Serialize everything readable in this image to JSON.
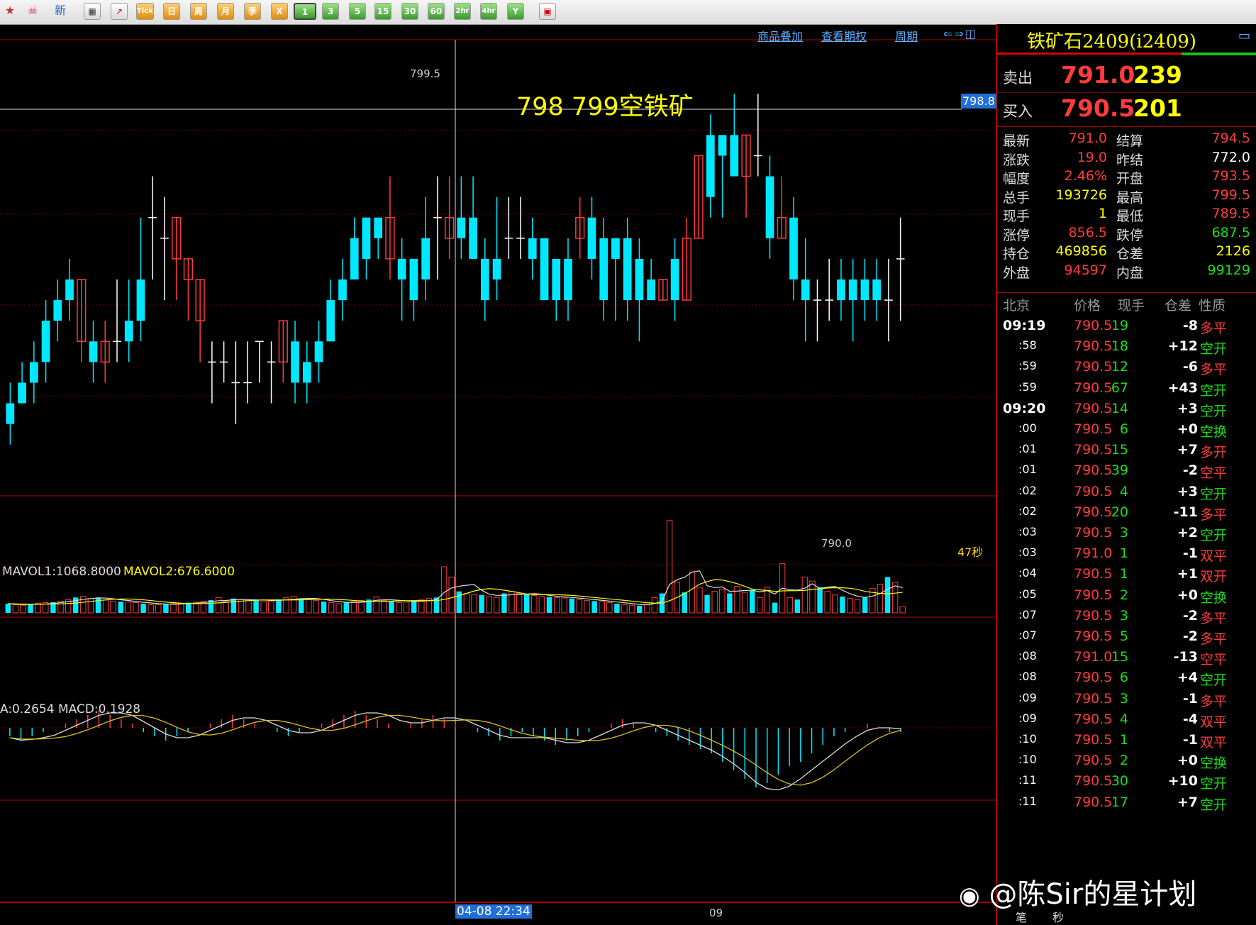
{
  "toolbar": {
    "buttons": [
      "新",
      "Tick",
      "日",
      "周",
      "月",
      "季",
      "X",
      "1",
      "3",
      "5",
      "15",
      "30",
      "60",
      "2hr",
      "4hr",
      "Y"
    ]
  },
  "chart_header": {
    "links": [
      "商品叠加",
      "查看期权",
      "周期"
    ]
  },
  "price_chart": {
    "high_label": "799.5",
    "low_label": "790.0",
    "cursor_price": "798.8",
    "annotation": "798 799空铁矿",
    "countdown": "47秒"
  },
  "volume_panel": {
    "legend1": "MAVOL1:1068.8000",
    "legend2": "MAVOL2:676.6000"
  },
  "macd_panel": {
    "legend": "A:0.2654 MACD:0.1928"
  },
  "time_axis": {
    "cursor_time": "04-08 22:34",
    "tick": "09"
  },
  "quote": {
    "title": "铁矿石2409(i2409)",
    "sell_label": "卖出",
    "sell_price": "791.0",
    "sell_qty": "239",
    "buy_label": "买入",
    "buy_price": "790.5",
    "buy_qty": "201",
    "stats": [
      {
        "l1": "最新",
        "v1": "791.0",
        "l2": "结算",
        "v2": "794.5"
      },
      {
        "l1": "涨跌",
        "v1": "19.0",
        "l2": "昨结",
        "v2": "772.0"
      },
      {
        "l1": "幅度",
        "v1": "2.46%",
        "l2": "开盘",
        "v2": "793.5"
      },
      {
        "l1": "总手",
        "v1": "193726",
        "l2": "最高",
        "v2": "799.5"
      },
      {
        "l1": "现手",
        "v1": "1",
        "l2": "最低",
        "v2": "789.5"
      },
      {
        "l1": "涨停",
        "v1": "856.5",
        "l2": "跌停",
        "v2": "687.5"
      },
      {
        "l1": "持仓",
        "v1": "469856",
        "l2": "仓差",
        "v2": "2126"
      },
      {
        "l1": "外盘",
        "v1": "94597",
        "l2": "内盘",
        "v2": "99129"
      }
    ],
    "trades_header": [
      "北京",
      "价格",
      "现手",
      "仓差",
      "性质"
    ],
    "trades": [
      {
        "t": "09:19",
        "p": "790.5",
        "q": "19",
        "d": "-8",
        "n": "多平"
      },
      {
        "t": ":58",
        "p": "790.5",
        "q": "18",
        "d": "+12",
        "n": "空开"
      },
      {
        "t": ":59",
        "p": "790.5",
        "q": "12",
        "d": "-6",
        "n": "多平"
      },
      {
        "t": ":59",
        "p": "790.5",
        "q": "67",
        "d": "+43",
        "n": "空开"
      },
      {
        "t": "09:20",
        "p": "790.5",
        "q": "14",
        "d": "+3",
        "n": "空开"
      },
      {
        "t": ":00",
        "p": "790.5",
        "q": "6",
        "d": "+0",
        "n": "空换"
      },
      {
        "t": ":01",
        "p": "790.5",
        "q": "15",
        "d": "+7",
        "n": "多开"
      },
      {
        "t": ":01",
        "p": "790.5",
        "q": "39",
        "d": "-2",
        "n": "空平"
      },
      {
        "t": ":02",
        "p": "790.5",
        "q": "4",
        "d": "+3",
        "n": "空开"
      },
      {
        "t": ":02",
        "p": "790.5",
        "q": "20",
        "d": "-11",
        "n": "多平"
      },
      {
        "t": ":03",
        "p": "790.5",
        "q": "3",
        "d": "+2",
        "n": "空开"
      },
      {
        "t": ":03",
        "p": "791.0",
        "q": "1",
        "d": "-1",
        "n": "双平"
      },
      {
        "t": ":04",
        "p": "790.5",
        "q": "1",
        "d": "+1",
        "n": "双开"
      },
      {
        "t": ":05",
        "p": "790.5",
        "q": "2",
        "d": "+0",
        "n": "空换"
      },
      {
        "t": ":07",
        "p": "790.5",
        "q": "3",
        "d": "-2",
        "n": "多平"
      },
      {
        "t": ":07",
        "p": "790.5",
        "q": "5",
        "d": "-2",
        "n": "多平"
      },
      {
        "t": ":08",
        "p": "791.0",
        "q": "15",
        "d": "-13",
        "n": "空平"
      },
      {
        "t": ":08",
        "p": "790.5",
        "q": "6",
        "d": "+4",
        "n": "空开"
      },
      {
        "t": ":09",
        "p": "790.5",
        "q": "3",
        "d": "-1",
        "n": "多平"
      },
      {
        "t": ":09",
        "p": "790.5",
        "q": "4",
        "d": "-4",
        "n": "双平"
      },
      {
        "t": ":10",
        "p": "790.5",
        "q": "1",
        "d": "-1",
        "n": "双平"
      },
      {
        "t": ":10",
        "p": "790.5",
        "q": "2",
        "d": "+0",
        "n": "空换"
      },
      {
        "t": ":11",
        "p": "790.5",
        "q": "30",
        "d": "+10",
        "n": "空开"
      },
      {
        "t": ":11",
        "p": "790.5",
        "q": "17",
        "d": "+7",
        "n": "空开"
      }
    ],
    "bottom_tabs": [
      "笔",
      "秒"
    ]
  },
  "watermark": "@陈Sir的星计划",
  "colors": {
    "up": "#ff3b3b",
    "down": "#00e8ff",
    "yellow": "#ffff00",
    "grid": "#7a0000"
  },
  "chart_data": {
    "type": "candlestick",
    "ohlc": [
      [
        792.0,
        791.5,
        792.5,
        791.0
      ],
      [
        792.5,
        792.0,
        793.0,
        792.0
      ],
      [
        793.0,
        792.5,
        793.5,
        792.0
      ],
      [
        794.0,
        793.0,
        794.5,
        792.5
      ],
      [
        794.5,
        794.0,
        795.0,
        793.5
      ],
      [
        795.0,
        794.5,
        795.5,
        794.0
      ],
      [
        793.5,
        795.0,
        795.0,
        793.0
      ],
      [
        793.5,
        793.0,
        794.0,
        792.5
      ],
      [
        793.0,
        793.5,
        794.0,
        792.5
      ],
      [
        793.5,
        793.5,
        795.0,
        793.0
      ],
      [
        794.0,
        793.5,
        795.0,
        793.0
      ],
      [
        795.0,
        794.0,
        796.5,
        793.5
      ],
      [
        796.5,
        796.5,
        797.5,
        795.0
      ],
      [
        796.0,
        796.0,
        797.0,
        794.5
      ],
      [
        795.5,
        796.5,
        796.5,
        794.5
      ],
      [
        795.0,
        795.5,
        795.5,
        794.0
      ],
      [
        794.0,
        795.0,
        795.0,
        793.0
      ],
      [
        793.0,
        793.0,
        793.5,
        792.0
      ],
      [
        793.0,
        793.0,
        793.5,
        792.5
      ],
      [
        792.5,
        792.5,
        793.5,
        791.5
      ],
      [
        792.5,
        792.5,
        793.5,
        792.0
      ],
      [
        793.5,
        793.5,
        793.5,
        792.5
      ],
      [
        793.0,
        793.0,
        793.5,
        792.0
      ],
      [
        793.0,
        794.0,
        794.0,
        792.5
      ],
      [
        793.5,
        792.5,
        794.0,
        792.0
      ],
      [
        793.0,
        792.5,
        793.5,
        792.0
      ],
      [
        793.5,
        793.0,
        794.0,
        792.5
      ],
      [
        794.5,
        793.5,
        795.0,
        793.5
      ],
      [
        795.0,
        794.5,
        795.5,
        794.0
      ],
      [
        796.0,
        795.0,
        796.5,
        795.0
      ],
      [
        796.5,
        795.5,
        796.5,
        795.0
      ],
      [
        796.5,
        796.0,
        796.5,
        795.5
      ],
      [
        795.5,
        796.5,
        797.5,
        795.0
      ],
      [
        795.5,
        795.0,
        796.0,
        794.0
      ],
      [
        795.5,
        794.5,
        795.5,
        794.0
      ],
      [
        796.0,
        795.0,
        797.0,
        794.5
      ],
      [
        796.5,
        796.5,
        797.5,
        795.0
      ],
      [
        796.0,
        796.5,
        797.5,
        795.5
      ],
      [
        796.5,
        796.0,
        797.5,
        795.5
      ],
      [
        796.5,
        795.5,
        797.5,
        795.5
      ],
      [
        795.5,
        794.5,
        796.0,
        794.0
      ],
      [
        795.5,
        795.0,
        797.0,
        794.5
      ],
      [
        796.0,
        796.0,
        797.0,
        795.5
      ],
      [
        796.0,
        796.0,
        797.0,
        795.5
      ],
      [
        796.0,
        795.5,
        796.5,
        795.0
      ],
      [
        796.0,
        794.5,
        796.0,
        794.5
      ],
      [
        795.5,
        794.5,
        795.5,
        794.0
      ],
      [
        795.5,
        794.5,
        796.0,
        794.0
      ],
      [
        796.0,
        796.5,
        797.0,
        795.5
      ],
      [
        796.5,
        795.5,
        797.0,
        795.0
      ],
      [
        796.0,
        794.5,
        796.5,
        794.0
      ],
      [
        796.0,
        795.5,
        796.0,
        794.0
      ],
      [
        796.0,
        794.5,
        796.5,
        794.0
      ],
      [
        795.5,
        794.5,
        796.0,
        793.5
      ],
      [
        795.0,
        794.5,
        795.5,
        794.5
      ],
      [
        794.5,
        795.0,
        795.0,
        794.5
      ],
      [
        795.5,
        794.5,
        796.0,
        794.0
      ],
      [
        794.5,
        796.0,
        796.5,
        794.5
      ],
      [
        796.0,
        798.0,
        798.0,
        796.0
      ],
      [
        798.5,
        797.0,
        799.0,
        796.5
      ],
      [
        798.5,
        798.0,
        798.5,
        796.5
      ],
      [
        798.5,
        797.5,
        799.5,
        797.5
      ],
      [
        797.5,
        798.5,
        798.5,
        796.5
      ],
      [
        798.0,
        798.0,
        799.5,
        797.5
      ],
      [
        797.5,
        796.0,
        798.0,
        795.5
      ],
      [
        796.0,
        796.5,
        797.5,
        796.0
      ],
      [
        796.5,
        795.0,
        797.0,
        794.5
      ],
      [
        795.0,
        794.5,
        796.0,
        793.5
      ],
      [
        794.5,
        794.5,
        795.0,
        793.5
      ],
      [
        794.5,
        794.5,
        795.5,
        794.0
      ],
      [
        795.0,
        794.5,
        795.5,
        794.0
      ],
      [
        795.0,
        794.5,
        795.5,
        793.5
      ],
      [
        795.0,
        794.5,
        795.5,
        794.0
      ],
      [
        795.0,
        794.5,
        795.5,
        794.0
      ],
      [
        794.5,
        794.5,
        795.5,
        793.5
      ],
      [
        795.5,
        795.5,
        796.5,
        794.0
      ]
    ],
    "ylim": [
      789.5,
      800.5
    ],
    "y_marks": [
      "799.5",
      "798.8",
      "790.0"
    ],
    "volume": [
      180,
      160,
      150,
      170,
      190,
      200,
      210,
      230,
      260,
      300,
      320,
      280,
      300,
      250,
      230,
      220,
      210,
      200,
      180,
      160,
      160,
      170,
      180,
      190,
      200,
      210,
      230,
      250,
      300,
      220,
      280,
      260,
      240,
      260,
      220,
      230,
      260,
      300,
      320,
      280,
      260,
      240,
      220,
      200,
      180,
      200,
      220,
      240,
      260,
      310,
      240,
      220,
      200,
      210,
      240,
      260,
      280,
      300,
      900,
      700,
      420,
      380,
      360,
      350,
      320,
      300,
      380,
      420,
      380,
      360,
      340,
      320,
      310,
      300,
      290,
      280,
      260,
      240,
      230,
      220,
      200,
      180,
      160,
      150,
      140,
      160,
      300,
      380,
      1800,
      600,
      400,
      800,
      500,
      350,
      420,
      460,
      380,
      520,
      400,
      450,
      300,
      500,
      200,
      960,
      300,
      260,
      700,
      620,
      500,
      420,
      350,
      320,
      280,
      260,
      300,
      480,
      560,
      700,
      600,
      120
    ],
    "macd_hist": [
      -2,
      -3,
      -2,
      -1,
      0,
      1,
      2,
      3,
      4,
      3,
      2,
      1,
      -1,
      -2,
      -3,
      -2,
      -1,
      0,
      1,
      2,
      3,
      2,
      1,
      0,
      -1,
      -2,
      -1,
      0,
      1,
      2,
      3,
      4,
      3,
      2,
      1,
      0,
      1,
      2,
      3,
      2,
      1,
      0,
      -1,
      -2,
      -3,
      -2,
      -1,
      -2,
      -3,
      -4,
      -3,
      -2,
      -1,
      0,
      1,
      2,
      1,
      0,
      -1,
      -2,
      -3,
      -4,
      -5,
      -6,
      -8,
      -10,
      -12,
      -14,
      -13,
      -11,
      -9,
      -8,
      -6,
      -4,
      -2,
      -1,
      0,
      1,
      0,
      -1,
      -1
    ]
  }
}
